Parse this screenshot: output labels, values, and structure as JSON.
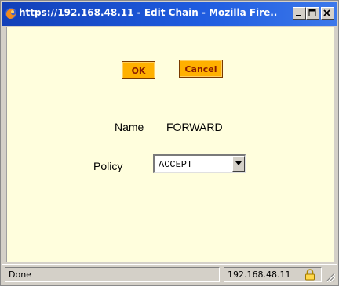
{
  "window": {
    "title": "https://192.168.48.11 - Edit Chain - Mozilla Fire...",
    "icon": "firefox-icon",
    "controls": [
      "minimize-icon",
      "maximize-icon",
      "close-icon"
    ]
  },
  "form": {
    "ok_label": "OK",
    "cancel_label": "Cancel",
    "name_label": "Name",
    "name_value": "FORWARD",
    "policy_label": "Policy",
    "policy_value": "ACCEPT"
  },
  "statusbar": {
    "status_text": "Done",
    "host": "192.168.48.11",
    "lock_icon": "lock-icon"
  },
  "colors": {
    "titlebar": "#1f5ce0",
    "content_bg": "#fffedd",
    "button_bg": "#ffb000",
    "button_text": "#8a1a00"
  }
}
